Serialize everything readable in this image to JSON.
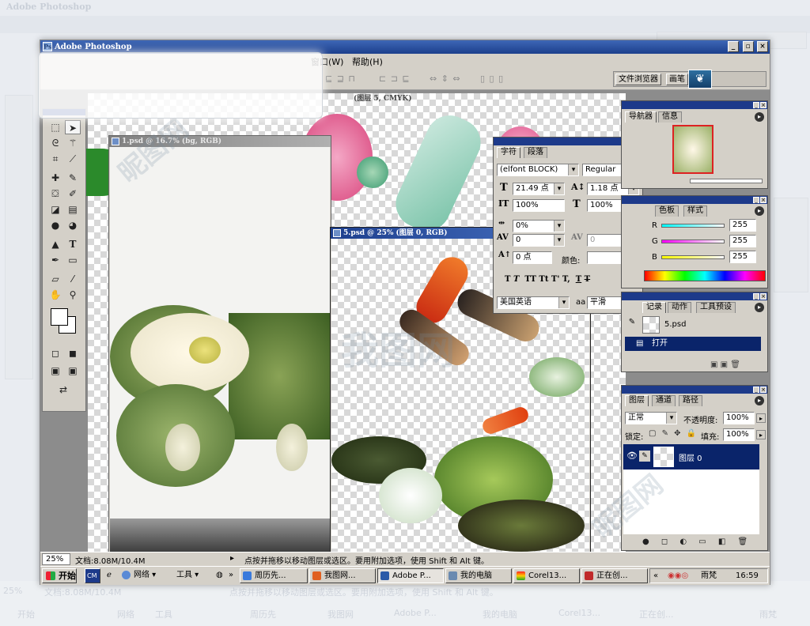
{
  "background": {
    "title": "Adobe Photoshop",
    "reflection": {
      "zoom": "25%",
      "doc_info": "文档:8.08M/10.4M",
      "hint": "点按并拖移以移动图层或选区。要用附加选项，使用 Shift 和 Alt 键。",
      "taskbar_items": [
        "开始",
        "网络",
        "工具",
        "周历先",
        "我图网",
        "Adobe P...",
        "我的电脑",
        "Corel13...",
        "正在创..."
      ],
      "tray_text": "雨梵"
    }
  },
  "window": {
    "title": "Adobe Photoshop",
    "controls": {
      "minimize": "_",
      "restore": "▫",
      "close": "×"
    }
  },
  "menubar": {
    "items": [
      "窗口(W)",
      "帮助(H)"
    ]
  },
  "options_bar": {
    "well_tabs": [
      "文件浏览器",
      "画笔"
    ]
  },
  "documents": [
    {
      "title": "1.psd @ 16.7% (bg, RGB)",
      "active": false
    },
    {
      "title": "(图层 5, CMYK)",
      "active": false
    },
    {
      "title": "5.psd @ 25% (图层 0, RGB)",
      "active": true
    }
  ],
  "toolbox": {
    "tools": [
      "marquee",
      "move",
      "lasso",
      "magic-wand",
      "crop",
      "slice",
      "healing",
      "brush",
      "stamp",
      "history-brush",
      "eraser",
      "gradient",
      "blur",
      "dodge",
      "path-select",
      "type",
      "pen",
      "shape",
      "notes",
      "eyedropper",
      "hand",
      "zoom"
    ]
  },
  "navigator_palette": {
    "tabs": [
      "导航器",
      "信息"
    ]
  },
  "color_palette": {
    "tabs": [
      "色板",
      "样式"
    ],
    "channels": [
      {
        "label": "R",
        "value": "255"
      },
      {
        "label": "G",
        "value": "255"
      },
      {
        "label": "B",
        "value": "255"
      }
    ]
  },
  "character_palette": {
    "tabs": [
      "字符",
      "段落"
    ],
    "font_family": "(elfont BLOCK)",
    "font_style": "Regular",
    "font_size": "21.49 点",
    "leading": "1.18 点",
    "vertical_scale": "100%",
    "horizontal_scale": "100%",
    "tracking_ratio": "0%",
    "kerning": "0",
    "tracking": "0",
    "baseline_shift": "0 点",
    "color_label": "颜色:",
    "language": "美国英语",
    "antialias_label": "aa",
    "antialias": "平滑",
    "style_buttons": [
      "T",
      "T",
      "TT",
      "Tt",
      "T'",
      "T,",
      "T",
      "T"
    ]
  },
  "history_palette": {
    "tabs": [
      "记录",
      "动作",
      "工具预设"
    ],
    "snapshot": "5.psd",
    "step": "打开"
  },
  "layers_palette": {
    "tabs": [
      "图层",
      "通道",
      "路径"
    ],
    "blend_mode": "正常",
    "opacity_label": "不透明度:",
    "opacity": "100%",
    "lock_label": "锁定:",
    "fill_label": "填充:",
    "fill": "100%",
    "layer_name": "图层 0"
  },
  "statusbar": {
    "zoom": "25%",
    "doc_info": "文档:8.08M/10.4M",
    "hint": "点按并拖移以移动图层或选区。要用附加选项，使用 Shift 和 Alt 键。"
  },
  "taskbar": {
    "start": "开始",
    "quick": [
      "CM"
    ],
    "network": "网络 ▾",
    "tools": "工具 ▾",
    "chevron": "»",
    "items": [
      "周历先...",
      "我图网...",
      "Adobe P...",
      "我的电脑",
      "Corel13...",
      "正在创..."
    ],
    "tray_chevron": "«",
    "tray_user": "雨梵",
    "clock": "16:59"
  },
  "colors": {
    "titlebar": "#1c3f8c",
    "panel": "#d4d0c8",
    "workspace": "#8c8c8c"
  }
}
